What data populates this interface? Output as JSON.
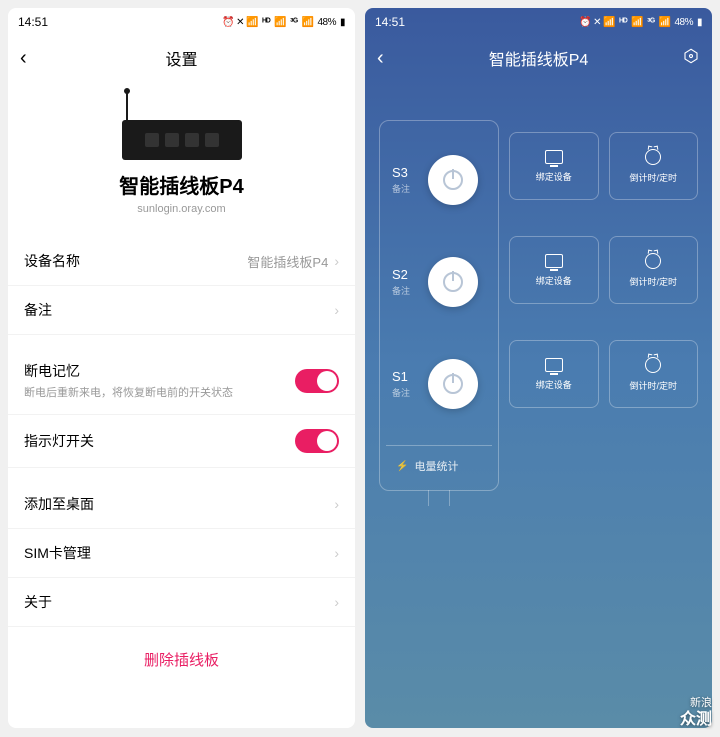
{
  "statusbar": {
    "time": "14:51",
    "indicators": "⏰ ✕ 📶 HD 📶 ᴴᴰ 📶 48%",
    "battery": "48%"
  },
  "left": {
    "title": "设置",
    "product_name": "智能插线板P4",
    "product_url": "sunlogin.oray.com",
    "rows": {
      "device_name_label": "设备名称",
      "device_name_value": "智能插线板P4",
      "remark_label": "备注",
      "power_memory_label": "断电记忆",
      "power_memory_sub": "断电后重新来电，将恢复断电前的开关状态",
      "led_switch_label": "指示灯开关",
      "add_desktop_label": "添加至桌面",
      "sim_label": "SIM卡管理",
      "about_label": "关于"
    },
    "delete_label": "删除插线板"
  },
  "right": {
    "title": "智能插线板P4",
    "sockets": [
      {
        "name": "S3",
        "note": "备注"
      },
      {
        "name": "S2",
        "note": "备注"
      },
      {
        "name": "S1",
        "note": "备注"
      }
    ],
    "stats_label": "电量统计",
    "tile_bind": "绑定设备",
    "tile_timer": "倒计时/定时"
  },
  "watermark": {
    "line1": "新浪",
    "line2": "众测"
  }
}
